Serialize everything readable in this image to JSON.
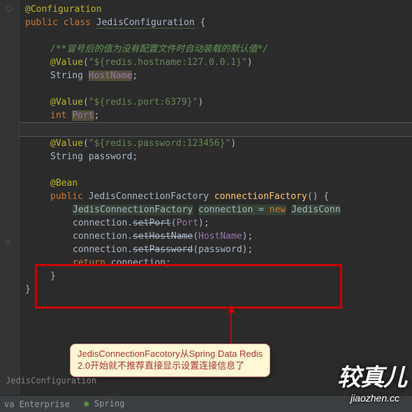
{
  "code": {
    "anno_config": "@Configuration",
    "kw_public": "public",
    "kw_class": "class",
    "cls_name": "JedisConfiguration",
    "brace_open": "{",
    "comment1": "/**冒号后的值为没有配置文件时自动装载的默认值*/",
    "anno_value": "@Value",
    "val_hostname": "\"${redis.hostname:127.0.0.1}\"",
    "type_string": "String",
    "field_hostname": "HostName",
    "val_port": "\"${redis.port:6379}\"",
    "type_int": "int",
    "field_port": "Port",
    "val_password": "\"${redis.password:123456}\"",
    "field_password": "password",
    "anno_bean": "@Bean",
    "cls_factory": "JedisConnectionFactory",
    "method_name": "connectionFactory",
    "paren": "()",
    "var_connection": "connection",
    "kw_new": "new",
    "cls_new": "JedisConn",
    "m_setport": "setPort",
    "m_sethost": "setHostName",
    "m_setpwd": "setPassword",
    "kw_return": "return",
    "semi": ";",
    "brace_close": "}",
    "eq": " = ",
    "dot": ".",
    "lparen": "(",
    "rparen": ")"
  },
  "callout": {
    "line1": "JedisConnectionFacotory从Spring Data Redis",
    "line2": "2.0开始就不推荐直接显示设置连接信息了"
  },
  "breadcrumb": "JedisConfiguration",
  "status": {
    "item1": "va Enterprise",
    "item2": "Spring"
  },
  "watermark": {
    "main": "较真儿",
    "sub": "jiaozhen.cc"
  }
}
